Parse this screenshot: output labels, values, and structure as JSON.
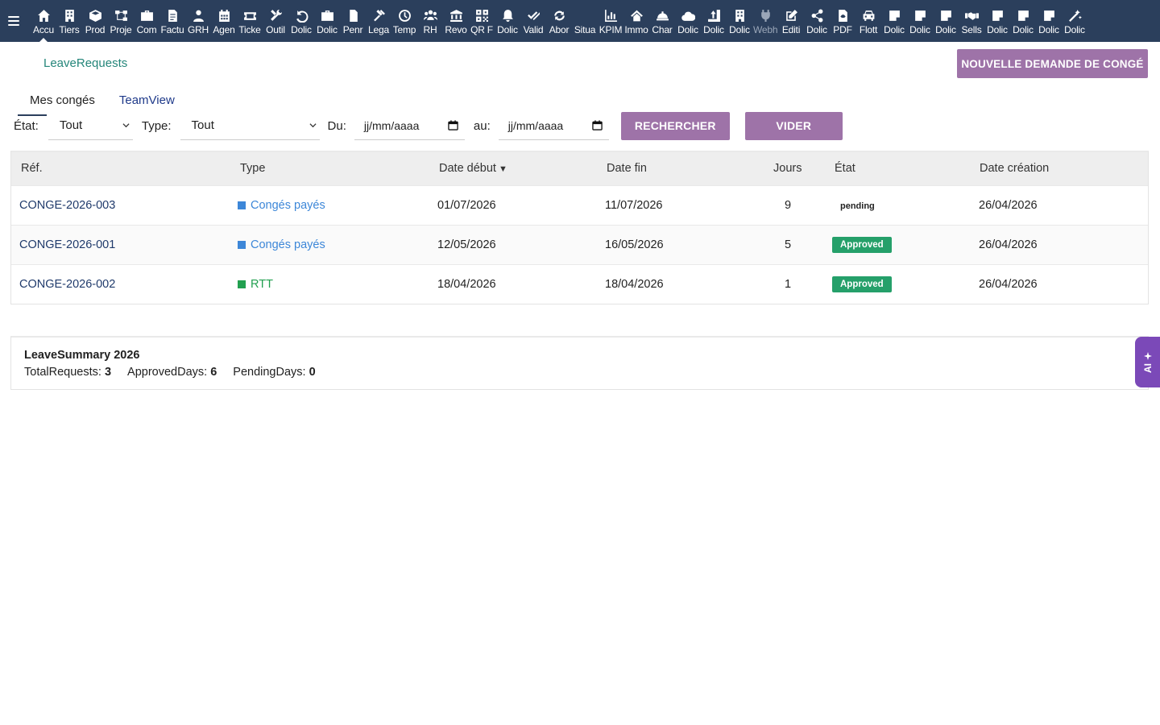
{
  "topbar": {
    "items": [
      {
        "label": "Accu",
        "icon": "home-icon"
      },
      {
        "label": "Tiers",
        "icon": "building-icon"
      },
      {
        "label": "Prod",
        "icon": "cube-icon"
      },
      {
        "label": "Proje",
        "icon": "sitemap-icon"
      },
      {
        "label": "Com",
        "icon": "briefcase-icon"
      },
      {
        "label": "Factu",
        "icon": "invoice-icon"
      },
      {
        "label": "GRH",
        "icon": "users-icon"
      },
      {
        "label": "Agen",
        "icon": "calendar-icon"
      },
      {
        "label": "Ticke",
        "icon": "ticket-icon"
      },
      {
        "label": "Outil",
        "icon": "tools-icon"
      },
      {
        "label": "Dolic",
        "icon": "undo-icon"
      },
      {
        "label": "Dolic",
        "icon": "briefcase-icon"
      },
      {
        "label": "Penr",
        "icon": "file-icon"
      },
      {
        "label": "Lega",
        "icon": "gavel-icon"
      },
      {
        "label": "Temp",
        "icon": "clock-icon"
      },
      {
        "label": "RH",
        "icon": "team-icon"
      },
      {
        "label": "Revo",
        "icon": "bank-icon"
      },
      {
        "label": "QR F",
        "icon": "qrcode-icon"
      },
      {
        "label": "Dolic",
        "icon": "bell-icon"
      },
      {
        "label": "Valid",
        "icon": "check-double-icon"
      },
      {
        "label": "Abor",
        "icon": "refresh-icon"
      },
      {
        "label": "Situa",
        "icon": "blank-icon"
      },
      {
        "label": "KPIM",
        "icon": "chart-bar-icon"
      },
      {
        "label": "Immo",
        "icon": "house-icon"
      },
      {
        "label": "Char",
        "icon": "hard-hat-icon"
      },
      {
        "label": "Dolic",
        "icon": "cloud-icon"
      },
      {
        "label": "Dolic",
        "icon": "upload-file-icon"
      },
      {
        "label": "Dolic",
        "icon": "building-icon"
      },
      {
        "label": "Webh",
        "icon": "plug-icon"
      },
      {
        "label": "Editi",
        "icon": "edit-icon"
      },
      {
        "label": "Dolic",
        "icon": "share-icon"
      },
      {
        "label": "PDF",
        "icon": "pdf-icon"
      },
      {
        "label": "Flott",
        "icon": "car-icon"
      },
      {
        "label": "Dolic",
        "icon": "note-icon"
      },
      {
        "label": "Dolic",
        "icon": "note-icon"
      },
      {
        "label": "Dolic",
        "icon": "note-icon"
      },
      {
        "label": "Sells",
        "icon": "handshake-icon"
      },
      {
        "label": "Dolic",
        "icon": "note-icon"
      },
      {
        "label": "Dolic",
        "icon": "note-icon"
      },
      {
        "label": "Dolic",
        "icon": "note-icon"
      },
      {
        "label": "Dolic",
        "icon": "magic-icon"
      }
    ]
  },
  "page": {
    "title": "LeaveRequests",
    "new_button": "NOUVELLE DEMANDE DE CONGÉ"
  },
  "tabs": [
    {
      "label": "Mes congés"
    },
    {
      "label": "TeamView"
    }
  ],
  "filters": {
    "state_label": "État:",
    "state_value": "Tout",
    "type_label": "Type:",
    "type_value": "Tout",
    "from_label": "Du:",
    "from_value": "jj/mm/aaaa",
    "to_label": "au:",
    "to_value": "jj/mm/aaaa",
    "search_button": "RECHERCHER",
    "clear_button": "VIDER"
  },
  "table": {
    "headers": [
      "Réf.",
      "Type",
      "Date début",
      "Date fin",
      "Jours",
      "État",
      "Date création"
    ],
    "sort_indicator": "▼",
    "rows": [
      {
        "ref": "CONGE-2026-003",
        "type": "Congés payés",
        "type_color": "#3d87d8",
        "start": "01/07/2026",
        "end": "11/07/2026",
        "days": "9",
        "state": "pending",
        "created": "26/04/2026"
      },
      {
        "ref": "CONGE-2026-001",
        "type": "Congés payés",
        "type_color": "#3d87d8",
        "start": "12/05/2026",
        "end": "16/05/2026",
        "days": "5",
        "state": "Approved",
        "created": "26/04/2026"
      },
      {
        "ref": "CONGE-2026-002",
        "type": "RTT",
        "type_color": "#22a050",
        "start": "18/04/2026",
        "end": "18/04/2026",
        "days": "1",
        "state": "Approved",
        "created": "26/04/2026"
      }
    ]
  },
  "summary": {
    "title": "LeaveSummary 2026",
    "total_label": "TotalRequests:",
    "total_value": "3",
    "approved_label": "ApprovedDays:",
    "approved_value": "6",
    "pending_label": "PendingDays:",
    "pending_value": "0"
  },
  "ai_tab": {
    "label": "AI"
  },
  "colors": {
    "topbar": "#2b3f5c",
    "accent": "#9e73a8",
    "approved": "#25a06a",
    "ai": "#7b49b8"
  }
}
